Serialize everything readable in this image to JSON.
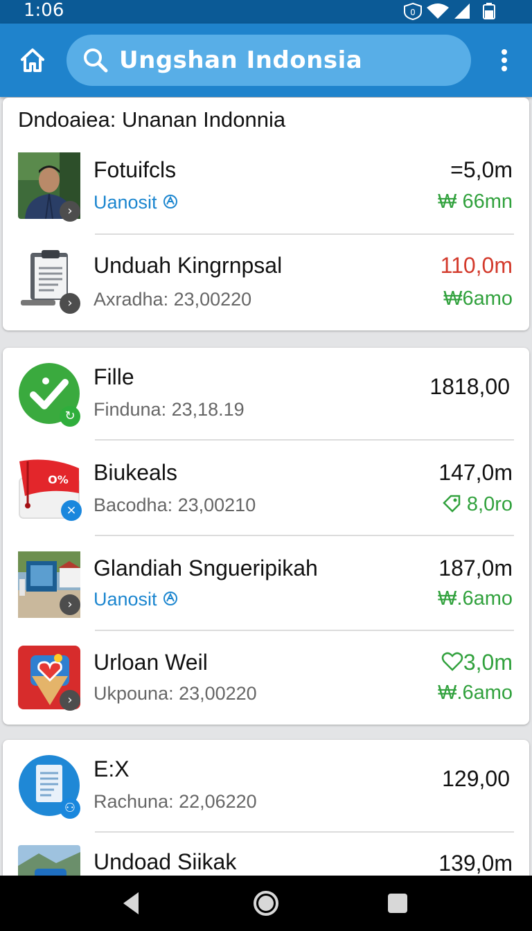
{
  "status": {
    "time": "1:06"
  },
  "search": {
    "query": "Ungshan Indonsia"
  },
  "cards": [
    {
      "title": "Dndoaiea: Unanan Indonnia",
      "rows": [
        {
          "name": "Fotuifcls",
          "sub": "Uanosit",
          "amount": "=5,0m",
          "amount2": "₩ 66mn"
        },
        {
          "name": "Unduah Kingrnpsal",
          "sub": "Axradha: 23,00220",
          "amount": "110,0m",
          "amount2": "₩6amo"
        }
      ]
    },
    {
      "rows": [
        {
          "name": "Fille",
          "sub": "Finduna: 23,18.19",
          "amount": "1818,00"
        },
        {
          "name": "Biukeals",
          "sub": "Bacodha: 23,00210",
          "amount": "147,0m",
          "amount2": "8,0ro",
          "badge_text": "O%"
        },
        {
          "name": "Glandiah Snguеripikah",
          "sub": "Uanosit",
          "amount": "187,0m",
          "amount2": "₩.6amo"
        },
        {
          "name": "Urloan Weil",
          "sub": "Ukpouna: 23,00220",
          "amount": "3,0m",
          "amount2": "₩.6amo"
        }
      ]
    },
    {
      "rows": [
        {
          "name": "E:X",
          "sub": "Rachuna: 22,06220",
          "amount": "129,00"
        },
        {
          "name": "Undoad Siikak",
          "amount": "139,0m"
        }
      ]
    }
  ],
  "colors": {
    "appbar": "#1f83cc",
    "statusbar": "#0b5a96",
    "positive": "#31a13d",
    "negative": "#d33a2c",
    "link": "#1c86cf"
  },
  "icons": [
    "home-icon",
    "search-icon",
    "more-vert-icon",
    "chevron-right-icon",
    "clipboard-icon",
    "check-circle-icon",
    "discount-tag-icon",
    "document-icon",
    "heart-icon",
    "back-icon",
    "home-circle-icon",
    "recents-icon"
  ]
}
